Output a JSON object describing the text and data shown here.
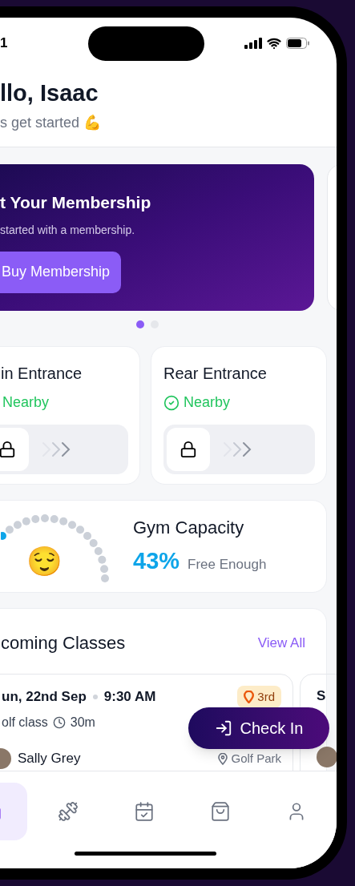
{
  "status_bar": {
    "time": "1"
  },
  "greeting": {
    "title": "llo, Isaac",
    "subtitle": "s get started 💪"
  },
  "promo_card": {
    "title": "t Your Membership",
    "text": "started with a membership.",
    "button": "Buy Membership"
  },
  "carousel_dots": [
    {
      "selected": true
    },
    {
      "selected": false
    }
  ],
  "entrances": [
    {
      "name": "in Entrance",
      "status": "Nearby"
    },
    {
      "name": "Rear Entrance",
      "status": "Nearby"
    }
  ],
  "capacity": {
    "emoji": "😌",
    "title": "Gym Capacity",
    "percent": "43%",
    "label": "Free Enough"
  },
  "classes": {
    "title": "coming Classes",
    "link": "View All",
    "items": [
      {
        "date": "un, 22nd Sep",
        "time": "9:30 AM",
        "badge": "3rd",
        "name": "olf class",
        "duration": "30m",
        "trainer": "Sally Grey",
        "location": "Golf Park"
      },
      {
        "date": "S"
      }
    ]
  },
  "check_in_button": "Check In",
  "nav": [
    {
      "kind": "home",
      "selected": true
    },
    {
      "kind": "dumbbell",
      "selected": false
    },
    {
      "kind": "calendar",
      "selected": false
    },
    {
      "kind": "bag",
      "selected": false
    },
    {
      "kind": "user",
      "selected": false
    }
  ]
}
